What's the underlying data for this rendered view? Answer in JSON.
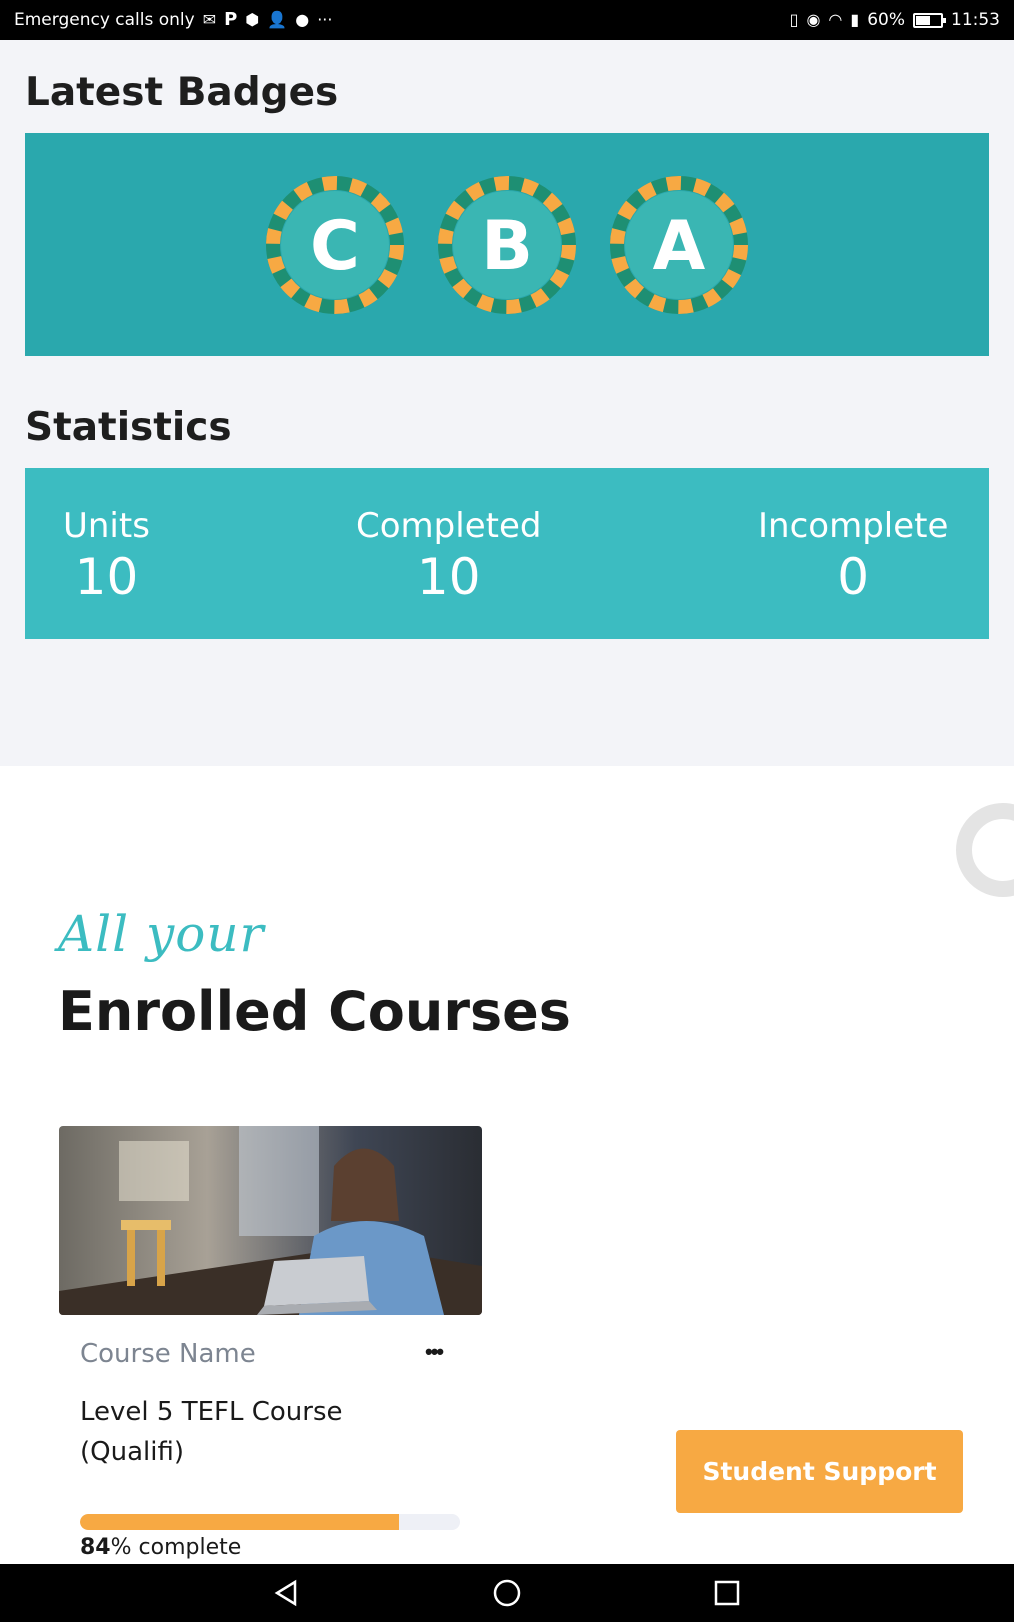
{
  "status_bar": {
    "carrier": "Emergency calls only",
    "left_icons": [
      "gmail-icon",
      "p-icon",
      "box-icon",
      "add-person-icon",
      "messenger-icon",
      "more-icon"
    ],
    "more_glyph": "···",
    "right_icons": [
      "vibrate-icon",
      "eye-icon",
      "wifi-icon",
      "battery-alert-icon"
    ],
    "battery_percent": "60%",
    "battery_level": 0.6,
    "time": "11:53"
  },
  "badges": {
    "title": "Latest Badges",
    "items": [
      {
        "letter": "C"
      },
      {
        "letter": "B"
      },
      {
        "letter": "A"
      }
    ],
    "colors": {
      "panel": "#2aa8ad",
      "ring": "#1e8f73",
      "dash": "#f7a943",
      "inner": "#3ab6b3"
    }
  },
  "statistics": {
    "title": "Statistics",
    "units_label": "Units",
    "units_value": "10",
    "completed_label": "Completed",
    "completed_value": "10",
    "incomplete_label": "Incomplete",
    "incomplete_value": "0",
    "color": "#3cbcc1"
  },
  "courses": {
    "script_heading": "All your",
    "heading": "Enrolled Courses",
    "card": {
      "label": "Course Name",
      "title": "Level 5 TEFL Course (Qualifi)",
      "progress_number": "84",
      "progress_suffix": "% complete",
      "progress": 0.84
    }
  },
  "support_button": "Student Support",
  "colors": {
    "accent": "#f7a943",
    "teal": "#3cbcc1"
  }
}
